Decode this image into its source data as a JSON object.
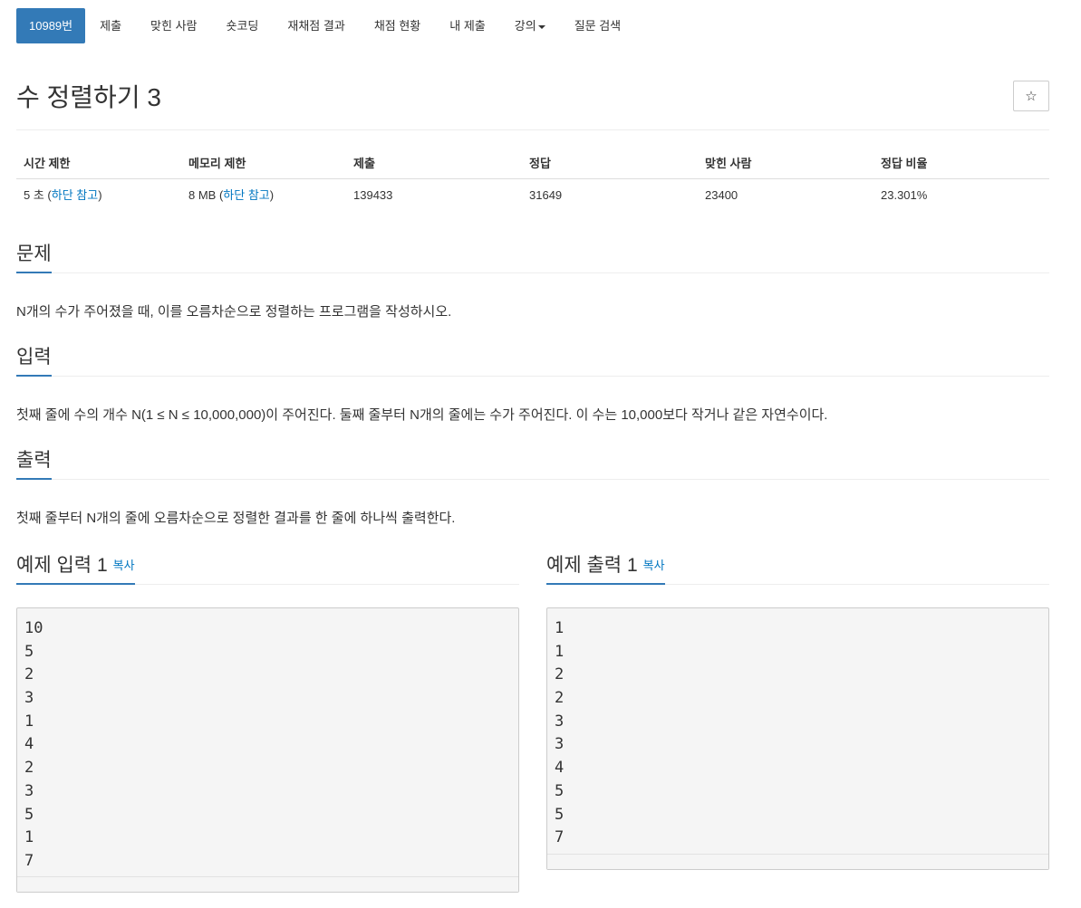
{
  "nav": {
    "items": [
      {
        "label": "10989번",
        "active": true
      },
      {
        "label": "제출"
      },
      {
        "label": "맞힌 사람"
      },
      {
        "label": "숏코딩"
      },
      {
        "label": "재채점 결과"
      },
      {
        "label": "채점 현황"
      },
      {
        "label": "내 제출"
      },
      {
        "label": "강의",
        "dropdown": true
      },
      {
        "label": "질문 검색"
      }
    ]
  },
  "problem": {
    "title": "수 정렬하기 3",
    "star_icon": "☆"
  },
  "info": {
    "headers": [
      "시간 제한",
      "메모리 제한",
      "제출",
      "정답",
      "맞힌 사람",
      "정답 비율"
    ],
    "time": {
      "value": "5 초 (",
      "link": "하단 참고",
      "close": ")"
    },
    "memory": {
      "value": "8 MB (",
      "link": "하단 참고",
      "close": ")"
    },
    "submissions": "139433",
    "accepted": "31649",
    "solvers": "23400",
    "ratio": "23.301%"
  },
  "sections": {
    "problem": {
      "title": "문제",
      "text": "N개의 수가 주어졌을 때, 이를 오름차순으로 정렬하는 프로그램을 작성하시오."
    },
    "input": {
      "title": "입력",
      "text": "첫째 줄에 수의 개수 N(1 ≤ N ≤ 10,000,000)이 주어진다. 둘째 줄부터 N개의 줄에는 수가 주어진다. 이 수는 10,000보다 작거나 같은 자연수이다."
    },
    "output": {
      "title": "출력",
      "text": "첫째 줄부터 N개의 줄에 오름차순으로 정렬한 결과를 한 줄에 하나씩 출력한다."
    }
  },
  "samples": {
    "input": {
      "title": "예제 입력 1",
      "copy": "복사",
      "lines": [
        "10",
        "5",
        "2",
        "3",
        "1",
        "4",
        "2",
        "3",
        "5",
        "1",
        "7"
      ]
    },
    "output": {
      "title": "예제 출력 1",
      "copy": "복사",
      "lines": [
        "1",
        "1",
        "2",
        "2",
        "3",
        "3",
        "4",
        "5",
        "5",
        "7"
      ]
    }
  },
  "colors": {
    "accent": "#337ab7",
    "link": "#0076c0",
    "pre_bg": "#f5f5f5"
  }
}
